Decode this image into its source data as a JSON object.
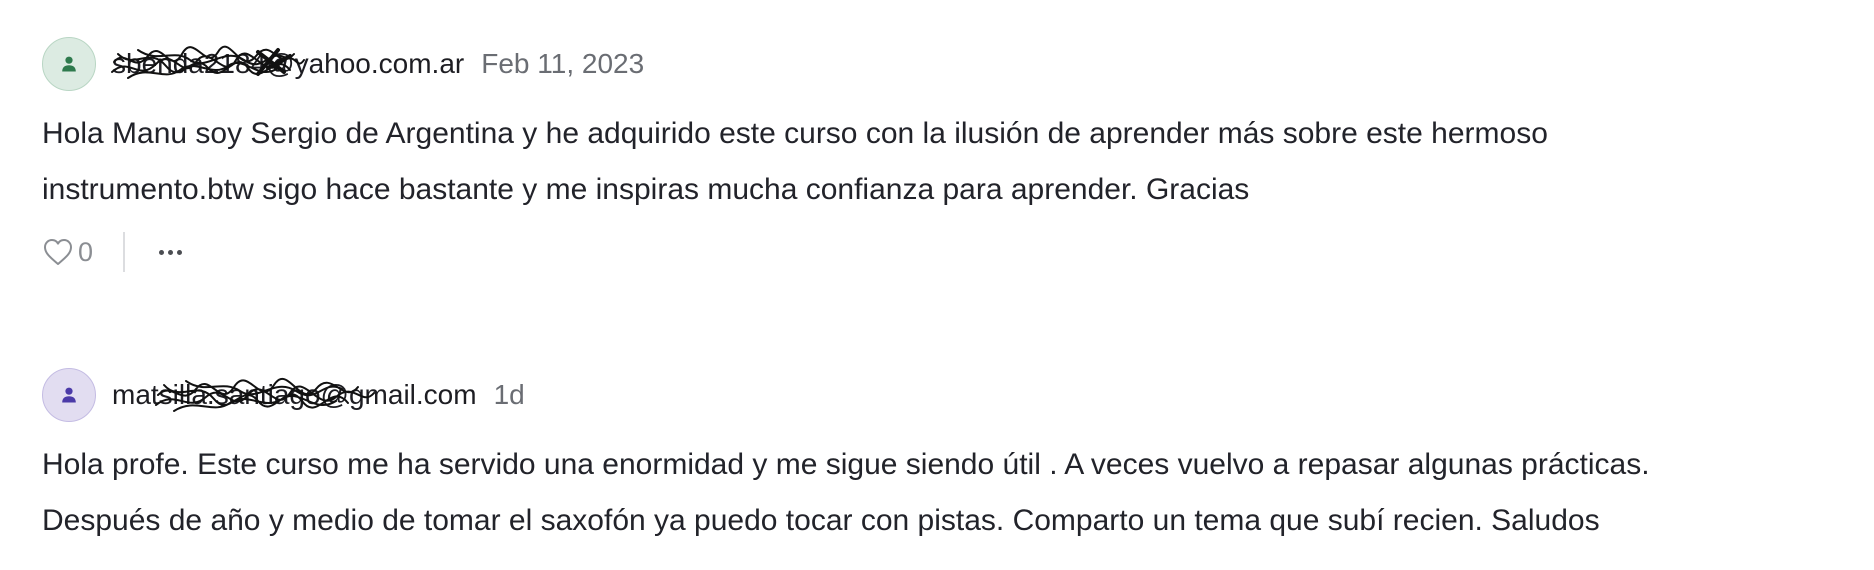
{
  "comments": [
    {
      "author": "sbenda2184@yahoo.com.ar",
      "timestamp": "Feb 11, 2023",
      "body_lines": [
        "Hola Manu soy Sergio de Argentina y he adquirido este curso con la ilusión de aprender más sobre este hermoso",
        "instrumento.btw sigo hace bastante y me inspiras mucha confianza para aprender. Gracias"
      ],
      "likes": "0",
      "avatar_icon": "user-icon",
      "avatar_bg": "#dcebe2",
      "avatar_fg": "#2e7a4d"
    },
    {
      "author": "matsilla.santiago@gmail.com",
      "timestamp": "1d",
      "body_lines": [
        "Hola profe. Este curso me ha servido una enormidad y me sigue siendo útil . A veces vuelvo a repasar algunas prácticas.",
        "Después de año y medio de tomar el saxofón ya puedo tocar con pistas. Comparto un tema que subí recien. Saludos"
      ],
      "avatar_icon": "user-icon",
      "avatar_bg": "#e2ddf1",
      "avatar_fg": "#4b3aa8"
    }
  ],
  "icons": {
    "like": "heart-icon",
    "more": "more-horizontal-icon"
  }
}
